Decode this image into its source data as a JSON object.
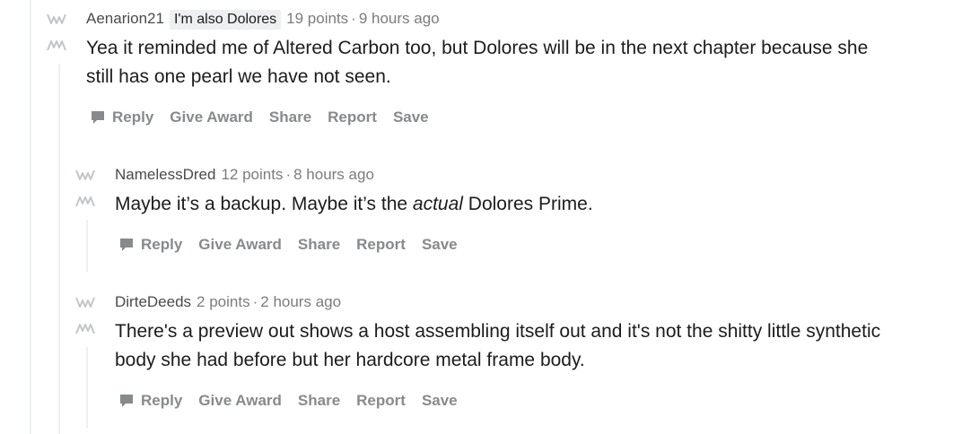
{
  "colors": {
    "thread_line": "#edeff1",
    "meta_text": "#7c7c7c",
    "action_text": "#878a8c",
    "body_text": "#1c1c1c",
    "flair_bg": "#edeff1"
  },
  "comments": [
    {
      "author": "Aenarion21",
      "flair": "I'm also Dolores",
      "points": "19 points",
      "separator": "·",
      "time": "9 hours ago",
      "lines": [
        "Yea it reminded me of Altered Carbon too, but Dolores will be in the next chapter because she",
        "still has one pearl we have not seen."
      ],
      "icons": {
        "up": "upvote-arrow-icon",
        "down": "downvote-arrow-icon",
        "reply": "comment-bubble-icon"
      },
      "actions": {
        "reply": "Reply",
        "award": "Give Award",
        "share": "Share",
        "report": "Report",
        "save": "Save"
      }
    },
    {
      "author": "NamelessDred",
      "points": "12 points",
      "separator": "·",
      "time": "8 hours ago",
      "text_before": "Maybe it’s a backup. Maybe it’s the ",
      "text_em": "actual",
      "text_after": " Dolores Prime.",
      "actions": {
        "reply": "Reply",
        "award": "Give Award",
        "share": "Share",
        "report": "Report",
        "save": "Save"
      }
    },
    {
      "author": "DirteDeeds",
      "points": "2 points",
      "separator": "·",
      "time": "2 hours ago",
      "lines": [
        "There's a preview out shows a host assembling itself out and it's not the shitty little synthetic",
        "body she had before but her hardcore metal frame body."
      ],
      "actions": {
        "reply": "Reply",
        "award": "Give Award",
        "share": "Share",
        "report": "Report",
        "save": "Save"
      }
    }
  ]
}
